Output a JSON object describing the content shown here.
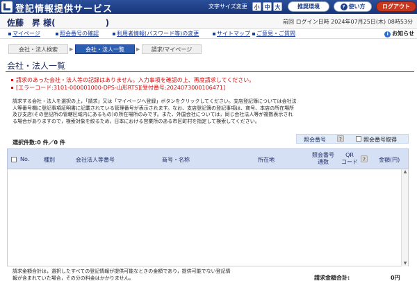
{
  "header": {
    "app_title": "登記情報提供サービス",
    "font_size_label": "文字サイズ変更",
    "font_sizes": [
      "小",
      "中",
      "大"
    ],
    "recommended_env": "推奨環境",
    "help": "使い方",
    "logout": "ログアウト"
  },
  "userbar": {
    "user_name": "佐藤　昇 様(　　　　　　)",
    "last_login": "前回 ログイン日時 2024年07月25日(木) 08時53分"
  },
  "nav": {
    "mypage": "マイページ",
    "verify": "照会番号の確認",
    "userinfo": "利用者情報(パスワード等)の変更",
    "sitemap": "サイトマップ",
    "opinion": "ご意見・ご質問",
    "notice": "お知らせ"
  },
  "steps": [
    "会社・法人検索",
    "会社・法人一覧",
    "請求/マイページ"
  ],
  "page_title": "会社・法人一覧",
  "errors": {
    "message": "請求のあった会社・法人等の記録はありません。入力事項を確認の上、再度請求してください。",
    "code": "[エラーコード:3101-000001000-DPS-山形RTS][受付番号:2024073000106471]"
  },
  "description": "請求する会社・法人を選択の上，「請求」又は「マイページへ登録」ボタンをクリックしてください。支店登記簿については会社法人等番号欄に登記事項証明書に記載されている管理番号が表示されます。なお、支店登記簿の登記事項は、商号、本店の所在場所及び支店(その登記所の管轄区域内にあるもの)の所在場所のみです。また、外国会社については，同じ会社法人等が複数表示される場合がありますので，検索対象を絞るため，日本における営業所のある市区町村を指定して検索してください。",
  "cert": {
    "label": "照会番号",
    "help": "?",
    "checkbox_label": "照会番号取得"
  },
  "selected_count": "選択件数:0 件／0 件",
  "table": {
    "no": "No.",
    "type": "種別",
    "corp_no": "会社法人等番号",
    "name": "商号・名称",
    "address": "所在地",
    "cert_count": "照会番号\n通数",
    "qr": "QR\nコード",
    "help": "?",
    "amount": "金額(円)",
    "rows": []
  },
  "footer": {
    "note": "請求金額合計は，選択したすべての登記情報が提供可能なときの金額であり，提供可能でない登記情報が含まれていた場合，その分の料金はかかりません。",
    "total_label": "請求金額合計:",
    "total_value": "0円"
  },
  "colors": {
    "header_bg": "#1e3f8a",
    "accent": "#2b5db0",
    "error": "#d01010",
    "logout": "#c8381e"
  }
}
